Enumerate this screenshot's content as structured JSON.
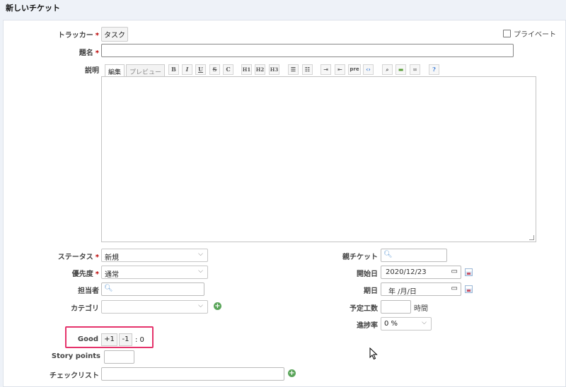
{
  "header": {
    "title": "新しいチケット"
  },
  "form": {
    "tracker": {
      "label": "トラッカー",
      "value": "タスク"
    },
    "private": {
      "label": "プライベート",
      "checked": false
    },
    "subject": {
      "label": "題名",
      "value": ""
    },
    "description": {
      "label": "説明",
      "tab_edit": "編集",
      "tab_preview": "プレビュー",
      "toolbar": [
        "B",
        "I",
        "U",
        "S",
        "C",
        "H1",
        "H2",
        "H3",
        "ul",
        "ol",
        "indent",
        "outdent",
        "pre",
        "code",
        "image-search",
        "image",
        "link",
        "help"
      ],
      "value": ""
    },
    "status": {
      "label": "ステータス",
      "value": "新規"
    },
    "priority": {
      "label": "優先度",
      "value": "通常"
    },
    "assignee": {
      "label": "担当者",
      "value": ""
    },
    "category": {
      "label": "カテゴリ",
      "value": ""
    },
    "parent": {
      "label": "親チケット",
      "value": ""
    },
    "start_date": {
      "label": "開始日",
      "value": "2020/12/23"
    },
    "due_date": {
      "label": "期日",
      "value": "年 /月/日"
    },
    "estimated": {
      "label": "予定工数",
      "value": "",
      "unit": "時間"
    },
    "done_ratio": {
      "label": "進捗率",
      "value": "0 %"
    },
    "good": {
      "label": "Good",
      "plus": "+1",
      "minus": "-1",
      "score": ": 0"
    },
    "story_points": {
      "label": "Story points",
      "value": ""
    },
    "checklist": {
      "label": "チェックリスト",
      "value": ""
    }
  },
  "required_mark": "*",
  "colors": {
    "highlight": "#e5336b",
    "required": "#bb0000",
    "add": "#5aa55a"
  },
  "icons": {
    "calendar": "calendar-icon",
    "search": "search-icon",
    "add": "plus-circle-icon",
    "cursor": "mouse-pointer-icon"
  }
}
